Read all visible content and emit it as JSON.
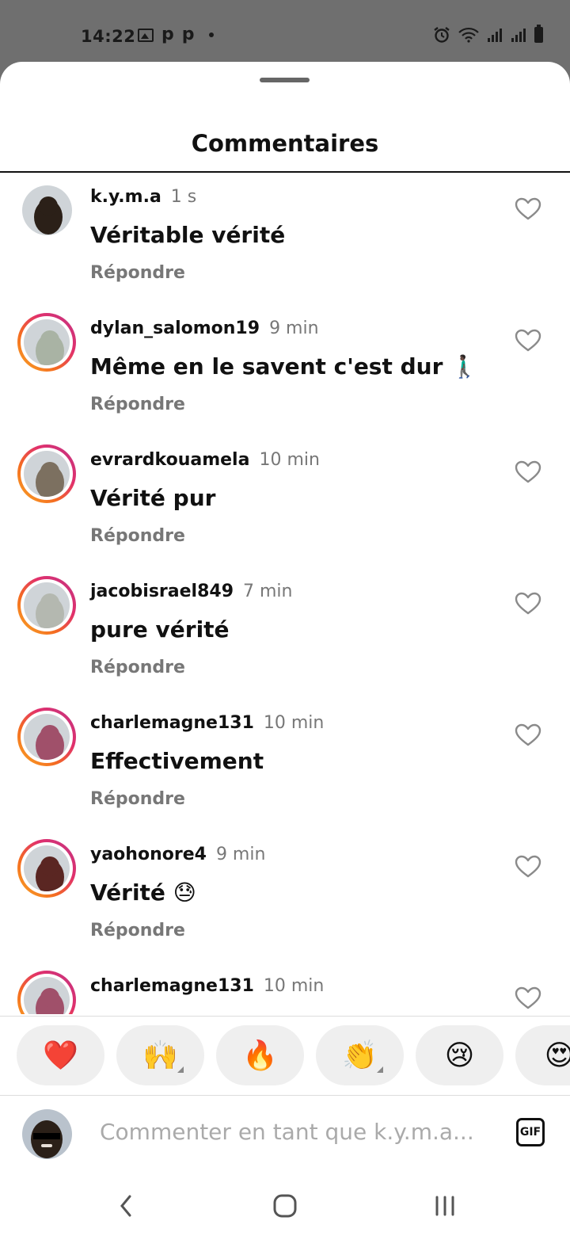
{
  "status_bar": {
    "time": "14:22",
    "left_icons": [
      "image-icon",
      "p-notification-icon",
      "p-notification-icon",
      "dot-icon"
    ],
    "p_glyph": "p",
    "right_icons": [
      "alarm-icon",
      "wifi-icon",
      "signal-icon",
      "signal-icon",
      "battery-icon"
    ]
  },
  "sheet": {
    "title": "Commentaires"
  },
  "comments": [
    {
      "username": "k.y.m.a",
      "time": "1 s",
      "text": "Véritable vérité",
      "emoji": "",
      "reply_label": "Répondre",
      "ring": false,
      "avatar_color": "#2b2018"
    },
    {
      "username": "dylan_salomon19",
      "time": "9 min",
      "text": "Même en le savent c'est dur",
      "emoji": "🚶🏿‍♂️",
      "reply_label": "Répondre",
      "ring": true,
      "avatar_color": "#a9b3a4"
    },
    {
      "username": "evrardkouamela",
      "time": "10 min",
      "text": "Vérité pur",
      "emoji": "",
      "reply_label": "Répondre",
      "ring": true,
      "avatar_color": "#7c7060"
    },
    {
      "username": "jacobisrael849",
      "time": "7 min",
      "text": "pure vérité",
      "emoji": "",
      "reply_label": "Répondre",
      "ring": true,
      "avatar_color": "#b4b8b0"
    },
    {
      "username": "charlemagne131",
      "time": "10 min",
      "text": "Effectivement",
      "emoji": "",
      "reply_label": "Répondre",
      "ring": true,
      "avatar_color": "#a0506a"
    },
    {
      "username": "yaohonore4",
      "time": "9 min",
      "text": "Vérité",
      "emoji": "😓",
      "reply_label": "Répondre",
      "ring": true,
      "avatar_color": "#5a2622"
    },
    {
      "username": "charlemagne131",
      "time": "10 min",
      "text": "",
      "emoji": "",
      "reply_label": "",
      "ring": true,
      "avatar_color": "#a0506a"
    }
  ],
  "quick_reactions": [
    "❤️",
    "🙌",
    "🔥",
    "👏",
    "😢",
    "😍"
  ],
  "quick_reactions_with_variants": [
    1,
    3
  ],
  "composer": {
    "placeholder": "Commenter en tant que k.y.m.a...",
    "gif_label": "GIF"
  },
  "nav": {
    "icons": [
      "back-icon",
      "home-icon",
      "recent-apps-icon"
    ]
  },
  "colors": {
    "ring_start": "#f9a825",
    "ring_end": "#c13584",
    "meta_text": "#777777",
    "heart": "#e0245e"
  }
}
